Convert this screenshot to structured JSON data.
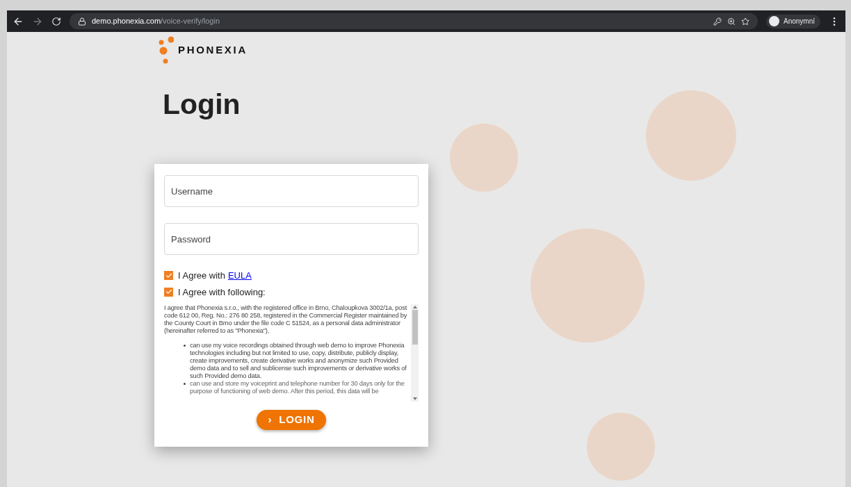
{
  "browser": {
    "url_host": "demo.phonexia.com",
    "url_path": "/voice-verify/login",
    "profile_label": "Anonymní"
  },
  "logo": {
    "text": "PHONEXIA"
  },
  "title": "Login",
  "form": {
    "fields": [
      {
        "placeholder": "Username"
      },
      {
        "placeholder": "Password"
      }
    ],
    "agreements": [
      {
        "label": "I Agree with",
        "link": "EULA",
        "checked": true
      },
      {
        "label": "I Agree with following:",
        "checked": true
      }
    ],
    "consent": {
      "intro": "I agree that Phonexia s.r.o., with the registered office in Brno, Chaloupkova 3002/1a, post code 612 00, Reg. No.: 276 80 258, registered in the Commercial Register maintained by the County Court in Brno under the file code C 51524, as a personal data administrator (hereinafter referred to as \"Phonexia\"),",
      "bullets": [
        "can use my voice recordings obtained through web demo to improve Phonexia technologies including but not limited to use, copy, distribute, publicly display, create improvements, create derivative works and anonymize such Provided demo data and to sell and sublicense such improvements or derivative works of such Provided demo data.",
        "can use and store my voiceprint and telephone number for 30 days only for the purpose of functioning of web demo. After this period, this data will be"
      ]
    },
    "login_button": {
      "icon": "›",
      "label": "LOGIN"
    }
  }
}
